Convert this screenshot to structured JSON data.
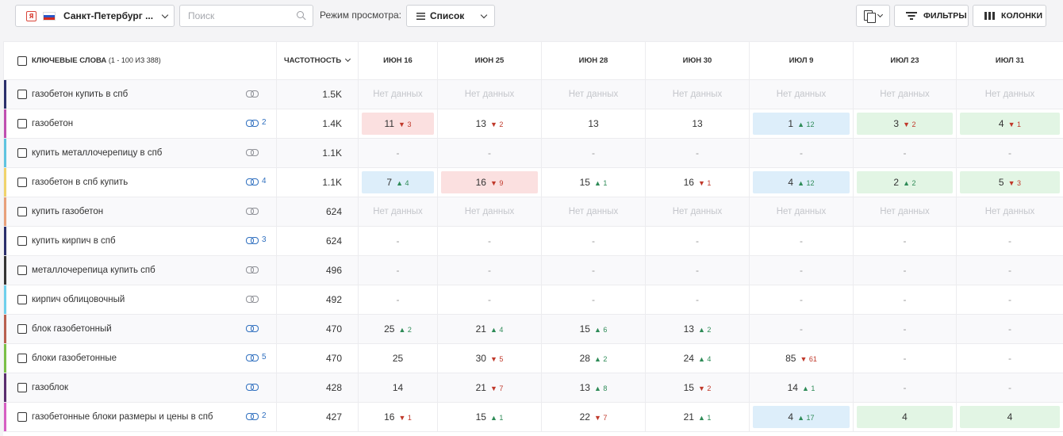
{
  "toolbar": {
    "region_label": "Санкт-Петербург ...",
    "region_logo": "Я",
    "search_placeholder": "Поиск",
    "view_label": "Режим просмотра:",
    "view_value": "Список",
    "filters_label": "ФИЛЬТРЫ",
    "columns_label": "КОЛОНКИ"
  },
  "table": {
    "kw_header": "КЛЮЧЕВЫЕ СЛОВА",
    "kw_header_sub": "(1 - 100 ИЗ 388)",
    "freq_header": "ЧАСТОТНОСТЬ",
    "dates": [
      "ИЮН 16",
      "ИЮН 25",
      "ИЮН 28",
      "ИЮН 30",
      "ИЮЛ 9",
      "ИЮЛ 23",
      "ИЮЛ 31"
    ],
    "rows": [
      {
        "kw": "газобетон купить в спб",
        "stripe": "#2b2f6b",
        "link_blue": false,
        "links": "",
        "freq": "1.5K",
        "cells": [
          {
            "v": "Нет данных",
            "t": "nd"
          },
          {
            "v": "Нет данных",
            "t": "nd"
          },
          {
            "v": "Нет данных",
            "t": "nd"
          },
          {
            "v": "Нет данных",
            "t": "nd"
          },
          {
            "v": "Нет данных",
            "t": "nd"
          },
          {
            "v": "Нет данных",
            "t": "nd"
          },
          {
            "v": "Нет данных",
            "t": "nd"
          }
        ]
      },
      {
        "kw": "газобетон",
        "stripe": "#c04fb0",
        "link_blue": true,
        "links": "2",
        "freq": "1.4K",
        "cells": [
          {
            "v": "11",
            "d": "3",
            "dir": "down",
            "bg": "#fbe0e0"
          },
          {
            "v": "13",
            "d": "2",
            "dir": "down"
          },
          {
            "v": "13"
          },
          {
            "v": "13"
          },
          {
            "v": "1",
            "d": "12",
            "dir": "up",
            "bg": "#ddeefa"
          },
          {
            "v": "3",
            "d": "2",
            "dir": "down",
            "bg": "#e2f5e4"
          },
          {
            "v": "4",
            "d": "1",
            "dir": "down",
            "bg": "#e2f5e4"
          }
        ]
      },
      {
        "kw": "купить металлочерепицу в спб",
        "stripe": "#5fc4e0",
        "link_blue": false,
        "links": "",
        "freq": "1.1K",
        "cells": [
          {
            "v": "-",
            "t": "dash"
          },
          {
            "v": "-",
            "t": "dash"
          },
          {
            "v": "-",
            "t": "dash"
          },
          {
            "v": "-",
            "t": "dash"
          },
          {
            "v": "-",
            "t": "dash"
          },
          {
            "v": "-",
            "t": "dash"
          },
          {
            "v": "-",
            "t": "dash"
          }
        ]
      },
      {
        "kw": "газобетон в спб купить",
        "stripe": "#f0d36b",
        "link_blue": true,
        "links": "4",
        "freq": "1.1K",
        "cells": [
          {
            "v": "7",
            "d": "4",
            "dir": "up",
            "bg": "#ddeefa"
          },
          {
            "v": "16",
            "d": "9",
            "dir": "down",
            "bg": "#fbe0e0"
          },
          {
            "v": "15",
            "d": "1",
            "dir": "up"
          },
          {
            "v": "16",
            "d": "1",
            "dir": "down"
          },
          {
            "v": "4",
            "d": "12",
            "dir": "up",
            "bg": "#ddeefa"
          },
          {
            "v": "2",
            "d": "2",
            "dir": "up",
            "bg": "#e2f5e4"
          },
          {
            "v": "5",
            "d": "3",
            "dir": "down",
            "bg": "#e2f5e4"
          }
        ]
      },
      {
        "kw": "купить газобетон",
        "stripe": "#e8a07a",
        "link_blue": false,
        "links": "",
        "freq": "624",
        "cells": [
          {
            "v": "Нет данных",
            "t": "nd"
          },
          {
            "v": "Нет данных",
            "t": "nd"
          },
          {
            "v": "Нет данных",
            "t": "nd"
          },
          {
            "v": "Нет данных",
            "t": "nd"
          },
          {
            "v": "Нет данных",
            "t": "nd"
          },
          {
            "v": "Нет данных",
            "t": "nd"
          },
          {
            "v": "Нет данных",
            "t": "nd"
          }
        ]
      },
      {
        "kw": "купить кирпич в спб",
        "stripe": "#2b2f6b",
        "link_blue": true,
        "links": "3",
        "freq": "624",
        "cells": [
          {
            "v": "-",
            "t": "dash"
          },
          {
            "v": "-",
            "t": "dash"
          },
          {
            "v": "-",
            "t": "dash"
          },
          {
            "v": "-",
            "t": "dash"
          },
          {
            "v": "-",
            "t": "dash"
          },
          {
            "v": "-",
            "t": "dash"
          },
          {
            "v": "-",
            "t": "dash"
          }
        ]
      },
      {
        "kw": "металлочерепица купить спб",
        "stripe": "#333333",
        "link_blue": false,
        "links": "",
        "freq": "496",
        "cells": [
          {
            "v": "-",
            "t": "dash"
          },
          {
            "v": "-",
            "t": "dash"
          },
          {
            "v": "-",
            "t": "dash"
          },
          {
            "v": "-",
            "t": "dash"
          },
          {
            "v": "-",
            "t": "dash"
          },
          {
            "v": "-",
            "t": "dash"
          },
          {
            "v": "-",
            "t": "dash"
          }
        ]
      },
      {
        "kw": "кирпич облицовочный",
        "stripe": "#6fd0ec",
        "link_blue": false,
        "links": "",
        "freq": "492",
        "cells": [
          {
            "v": "-",
            "t": "dash"
          },
          {
            "v": "-",
            "t": "dash"
          },
          {
            "v": "-",
            "t": "dash"
          },
          {
            "v": "-",
            "t": "dash"
          },
          {
            "v": "-",
            "t": "dash"
          },
          {
            "v": "-",
            "t": "dash"
          },
          {
            "v": "-",
            "t": "dash"
          }
        ]
      },
      {
        "kw": "блок газобетонный",
        "stripe": "#b8604f",
        "link_blue": true,
        "links": "",
        "freq": "470",
        "cells": [
          {
            "v": "25",
            "d": "2",
            "dir": "up"
          },
          {
            "v": "21",
            "d": "4",
            "dir": "up"
          },
          {
            "v": "15",
            "d": "6",
            "dir": "up"
          },
          {
            "v": "13",
            "d": "2",
            "dir": "up"
          },
          {
            "v": "-",
            "t": "dash"
          },
          {
            "v": "-",
            "t": "dash"
          },
          {
            "v": "-",
            "t": "dash"
          }
        ]
      },
      {
        "kw": "блоки газобетонные",
        "stripe": "#7ac046",
        "link_blue": true,
        "links": "5",
        "freq": "470",
        "cells": [
          {
            "v": "25"
          },
          {
            "v": "30",
            "d": "5",
            "dir": "down"
          },
          {
            "v": "28",
            "d": "2",
            "dir": "up"
          },
          {
            "v": "24",
            "d": "4",
            "dir": "up"
          },
          {
            "v": "85",
            "d": "61",
            "dir": "down"
          },
          {
            "v": "-",
            "t": "dash"
          },
          {
            "v": "-",
            "t": "dash"
          }
        ]
      },
      {
        "kw": "газоблок",
        "stripe": "#5a2d6e",
        "link_blue": true,
        "links": "",
        "freq": "428",
        "cells": [
          {
            "v": "14"
          },
          {
            "v": "21",
            "d": "7",
            "dir": "down"
          },
          {
            "v": "13",
            "d": "8",
            "dir": "up"
          },
          {
            "v": "15",
            "d": "2",
            "dir": "down"
          },
          {
            "v": "14",
            "d": "1",
            "dir": "up"
          },
          {
            "v": "-",
            "t": "dash"
          },
          {
            "v": "-",
            "t": "dash"
          }
        ]
      },
      {
        "kw": "газобетонные блоки размеры и цены в спб",
        "stripe": "#d65fc3",
        "link_blue": true,
        "links": "2",
        "freq": "427",
        "cells": [
          {
            "v": "16",
            "d": "1",
            "dir": "down"
          },
          {
            "v": "15",
            "d": "1",
            "dir": "up"
          },
          {
            "v": "22",
            "d": "7",
            "dir": "down"
          },
          {
            "v": "21",
            "d": "1",
            "dir": "up"
          },
          {
            "v": "4",
            "d": "17",
            "dir": "up",
            "bg": "#ddeefa"
          },
          {
            "v": "4",
            "bg": "#e2f5e4"
          },
          {
            "v": "4",
            "bg": "#e2f5e4"
          }
        ]
      }
    ]
  }
}
